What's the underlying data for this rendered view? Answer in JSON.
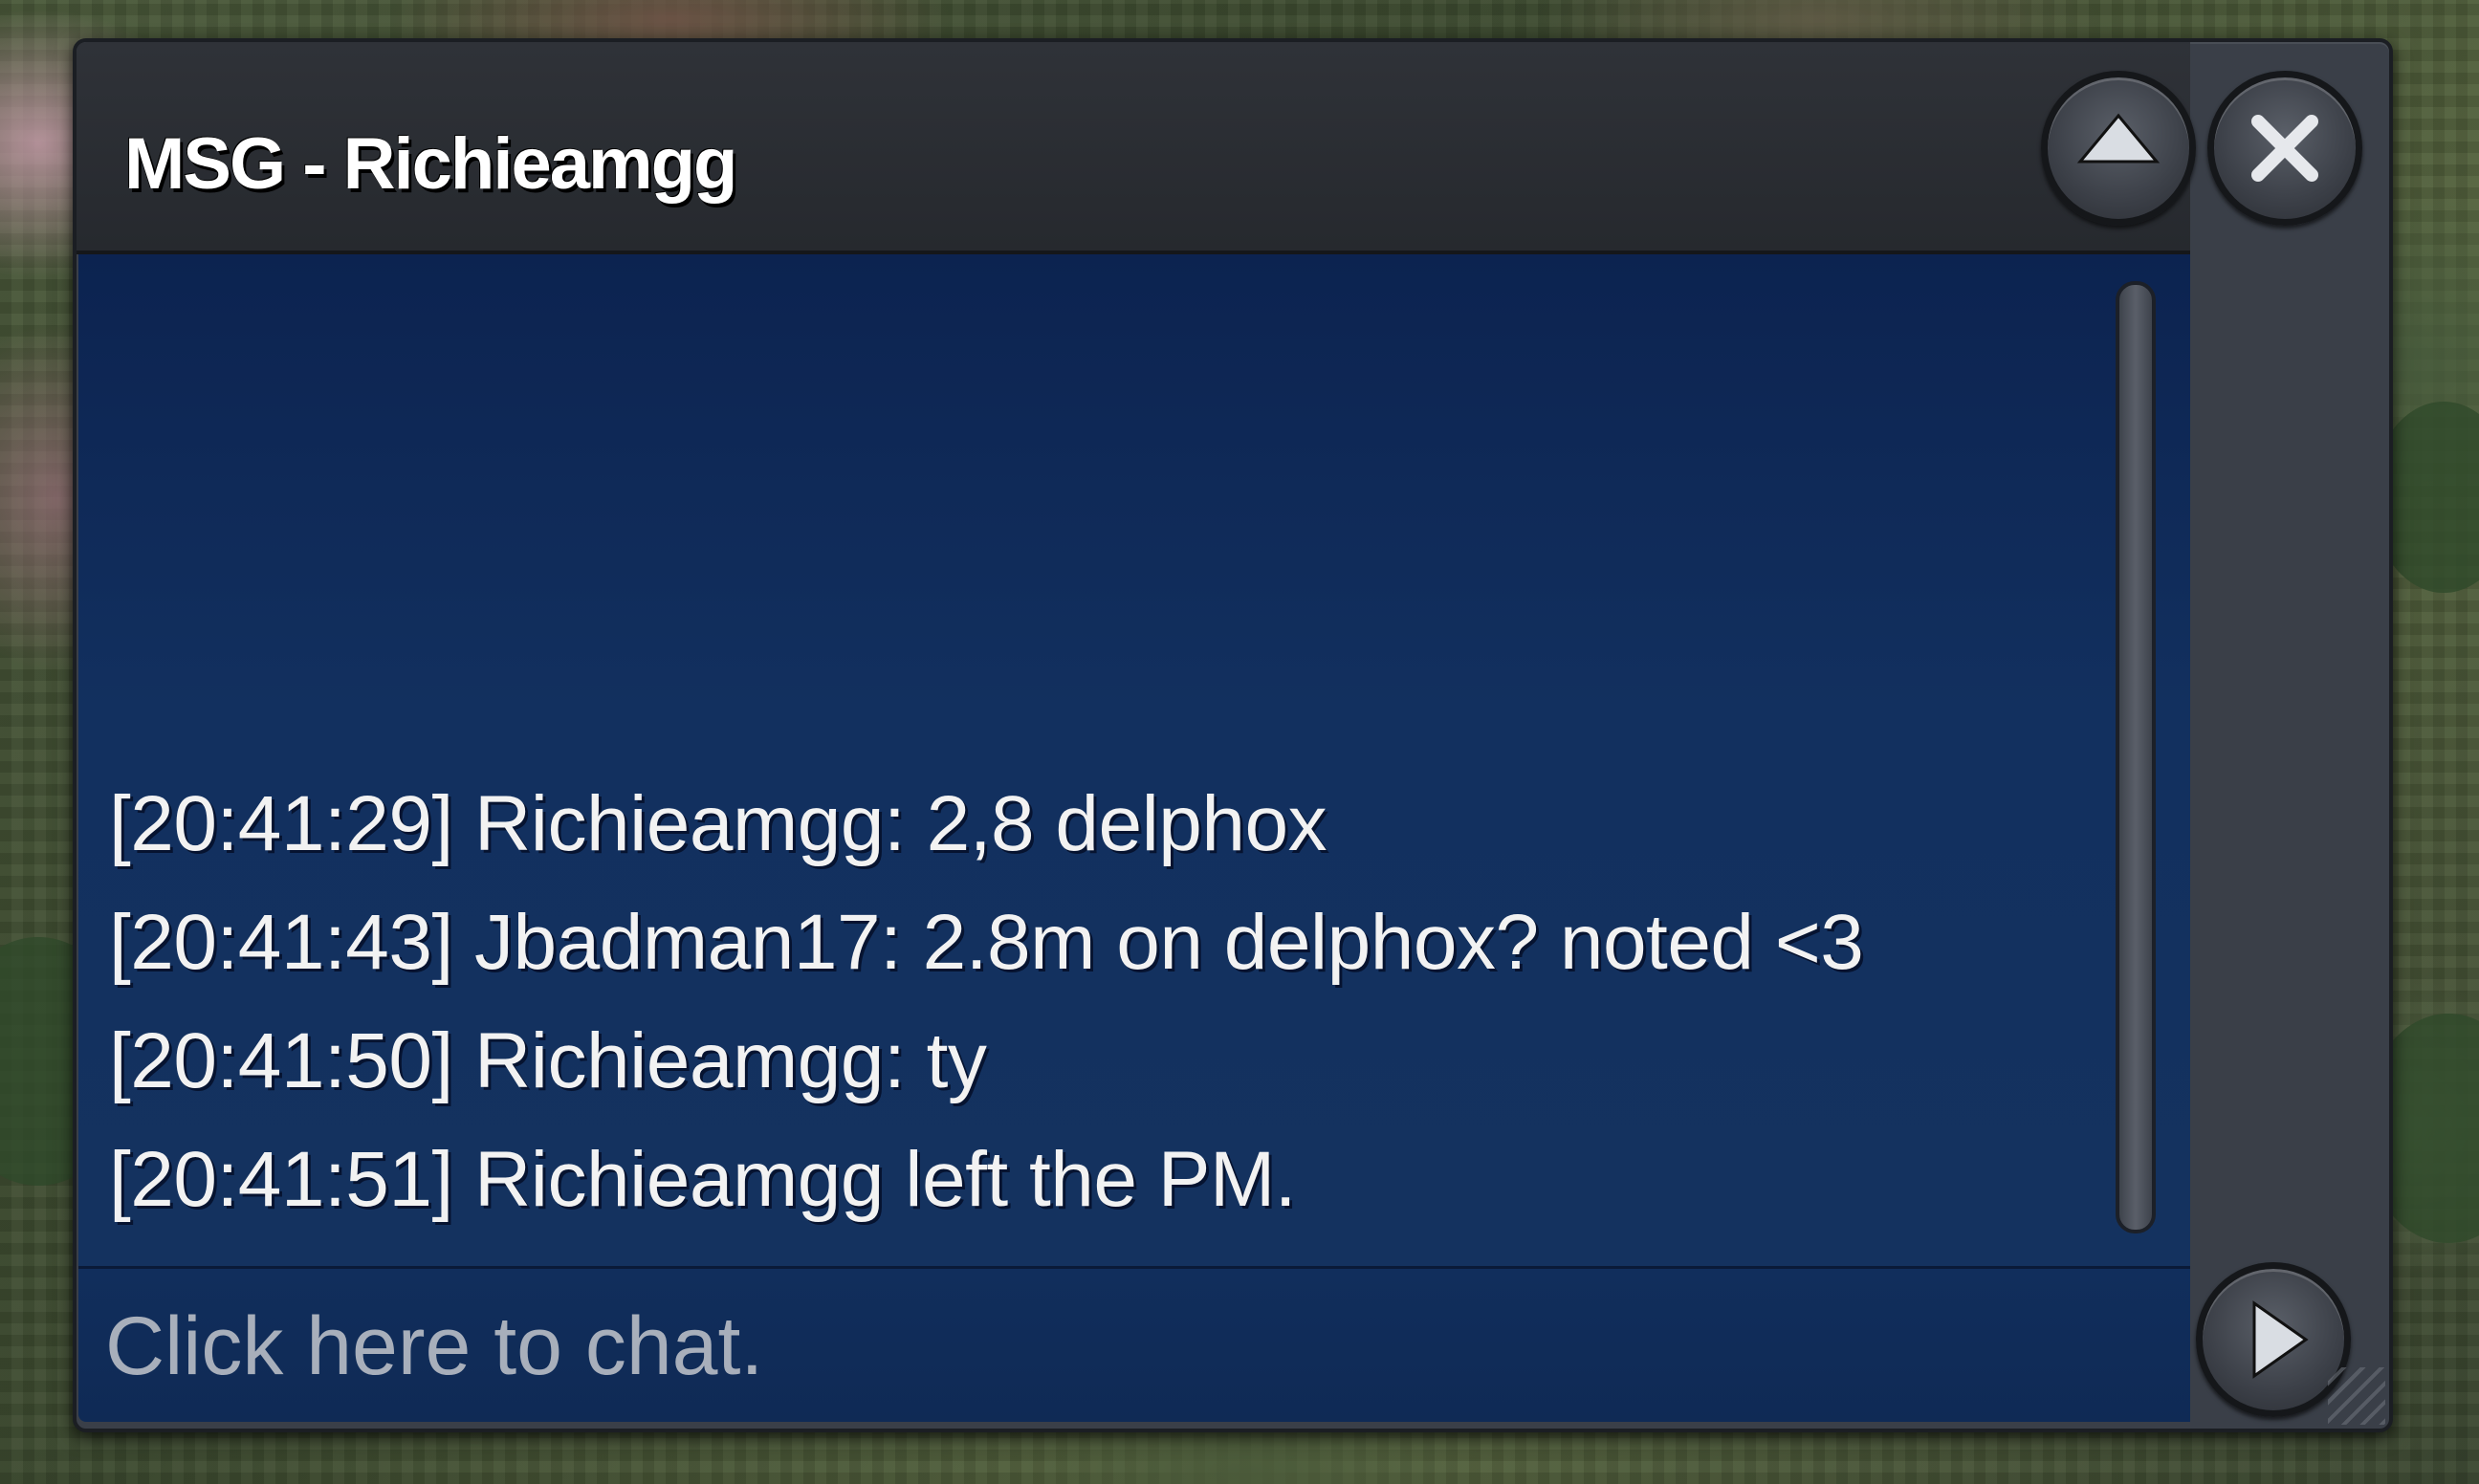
{
  "window": {
    "title": "MSG - Richieamgg"
  },
  "buttons": {
    "collapse_icon": "triangle-up-icon",
    "close_icon": "close-x-icon",
    "send_icon": "triangle-right-icon"
  },
  "messages": [
    {
      "text": "[20:41:29] Richieamgg: 2,8 delphox"
    },
    {
      "text": "[20:41:43] Jbadman17: 2.8m on delphox? noted <3"
    },
    {
      "text": "[20:41:50] Richieamgg: ty"
    },
    {
      "text": "[20:41:51] Richieamgg left the PM."
    }
  ],
  "input": {
    "placeholder": "Click here to chat."
  },
  "colors": {
    "chat_background": "#12305f",
    "window_frame": "#3a3f48",
    "text": "#f2f2f2"
  }
}
